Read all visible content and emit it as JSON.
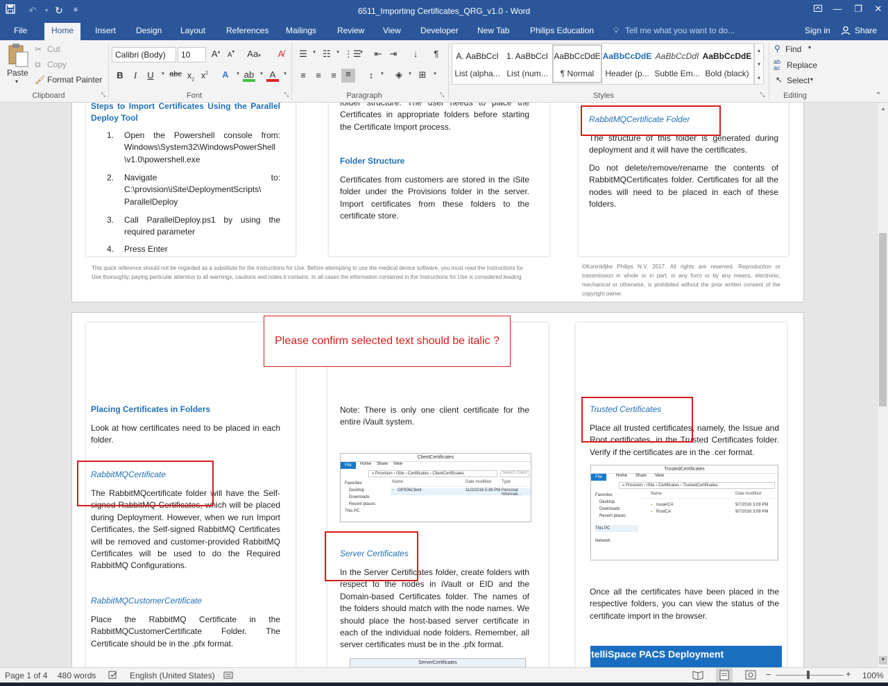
{
  "window": {
    "title": "6511_Importing Certificates_QRG_v1.0 - Word",
    "quick_access": {
      "save_icon": "save-icon",
      "undo_icon": "undo-icon",
      "redo_icon": "repeat-icon"
    }
  },
  "tabs": [
    "File",
    "Home",
    "Insert",
    "Design",
    "Layout",
    "References",
    "Mailings",
    "Review",
    "View",
    "Developer",
    "New Tab",
    "Philips Education"
  ],
  "active_tab": "Home",
  "tell_me_placeholder": "Tell me what you want to do...",
  "account": {
    "sign_in": "Sign in",
    "share": "Share"
  },
  "ribbon": {
    "clipboard": {
      "paste": "Paste",
      "cut": "Cut",
      "copy": "Copy",
      "format_painter": "Format Painter",
      "label": "Clipboard"
    },
    "font": {
      "font_name": "Calibri (Body)",
      "font_size": "10",
      "label": "Font"
    },
    "paragraph": {
      "label": "Paragraph"
    },
    "styles": {
      "label": "Styles",
      "items": [
        {
          "preview": "A. AaBbCcI",
          "name": "List (alpha..."
        },
        {
          "preview": "1. AaBbCcI",
          "name": "List (num..."
        },
        {
          "preview": "AaBbCcDdE",
          "name": "¶ Normal"
        },
        {
          "preview": "AaBbCcDdE",
          "name": "Header (p..."
        },
        {
          "preview": "AaBbCcDdI",
          "name": "Subtle Em..."
        },
        {
          "preview": "AaBbCcDdE",
          "name": "Bold (black)"
        }
      ]
    },
    "editing": {
      "find": "Find",
      "replace": "Replace",
      "select": "Select",
      "label": "Editing"
    }
  },
  "page1": {
    "col1": {
      "heading": "Steps to Import Certificates Using the Parallel Deploy Tool",
      "steps": [
        {
          "num": "1.",
          "text": "Open the Powershell console from: Windows\\System32\\WindowsPowerShell \\v1.0\\powershell.exe"
        },
        {
          "num": "2.",
          "text": "Navigate to: C:\\provision\\iSite\\DeploymentScripts\\ ParallelDeploy"
        },
        {
          "num": "3.",
          "text": "Call ParallelDeploy.ps1 by using the required parameter"
        },
        {
          "num": "4.",
          "text": "Press Enter"
        }
      ]
    },
    "col2": {
      "intro": "folder structure. The user needs to place the Certificates in appropriate folders before starting the Certificate Import process.",
      "heading": "Folder Structure",
      "body": "Certificates from customers are stored in the iSite folder under the Provisions folder in the server. Import certificates from these folders to the certificate store."
    },
    "col3": {
      "heading": "RabbitMQCertificate Folder",
      "p1": "The structure of this folder is generated during deployment and it will have the certificates.",
      "p2": "Do not delete/remove/rename the contents of RabbitMQCertificates folder. Certificates for all the nodes will need to be placed in each of these folders."
    },
    "footer_left": "This quick reference should not be regarded as a substitute for the Instructions for Use. Before attempting to use the medical device software, you must read the Instructions for Use thoroughly, paying particular attention to all warnings, cautions and notes it contains. In all cases the information contained in the Instructions for Use is considered leading.",
    "footer_right": "©Koninklijke Philips N.V. 2017. All rights are reserved. Reproduction or transmission in whole or in part, in any form or by any means, electronic, mechanical or otherwise, is prohibited without the prior written consent of the copyright owner."
  },
  "page2": {
    "comment": "Please confirm selected text should be italic ?",
    "col1": {
      "heading": "Placing Certificates in Folders",
      "intro": "Look at how certificates need to be placed in each folder.",
      "sub1": "RabbitMQCertificate",
      "body1": "The RabbitMQcertificate folder will have the Self-signed RabbitMQ Certificates, which will be placed during Deployment. However, when we run Import Certificates, the Self-signed RabbitMQ Certificates will be removed and customer-provided RabbitMQ Certificates will be used to do the Required RabbitMQ Configurations.",
      "sub2": "RabbitMQCustomerCertificate",
      "body2": "Place the RabbitMQ Certificate in the RabbitMQCustomerCertificate Folder. The Certificate should be in the .pfx format."
    },
    "col2": {
      "note": "Note: There is only one client certificate for the entire iVault system.",
      "shot1": {
        "title": "ClientCertificates",
        "menu": [
          "File",
          "Home",
          "Share",
          "View"
        ],
        "path": "« Provision › iSite › Certificates › ClientCertificates",
        "search": "Search Client",
        "nav": [
          "Favorites",
          "Desktop",
          "Downloads",
          "Recent places",
          "This PC"
        ],
        "cols": [
          "Name",
          "Date modified",
          "Type"
        ],
        "rows": [
          {
            "name": "OPS06Client",
            "date": "11/2/2016 5:36 PM",
            "type": "Personal Informati..."
          }
        ]
      },
      "sub": "Server Certificates",
      "body": "In the Server Certificates folder, create folders with respect to the nodes in iVault or EID and the Domain-based Certificates folder. The names of the folders should match with the node names. We should place the host-based server certificate in each of the individual node folders. Remember, all server certificates must be in the .pfx format.",
      "shot2_title": "ServerCertificates"
    },
    "col3": {
      "sub": "Trusted Certificates",
      "body": "Place all trusted certificates, namely, the Issue and Root certificates, in the Trusted Certificates folder. Verify if the certificates are in the .cer format.",
      "shot": {
        "title": "TrustedCertificates",
        "menu": [
          "File",
          "Home",
          "Share",
          "View"
        ],
        "path": "« Provision › iSite › Certificates › TrustedCertificates",
        "nav": [
          "Favorites",
          "Desktop",
          "Downloads",
          "Recent places",
          "This PC",
          "Network"
        ],
        "cols": [
          "Name",
          "Date modified"
        ],
        "rows": [
          {
            "name": "IssuerCA",
            "date": "9/7/2016 3:09 PM"
          },
          {
            "name": "RootCA",
            "date": "9/7/2016 3:09 PM"
          }
        ]
      },
      "body2": "Once all the certificates have been placed in the respective folders, you can view the status of the certificate import in the browser.",
      "banner": "telliSpace PACS Deployment"
    }
  },
  "status": {
    "page": "Page 1 of 4",
    "words": "480 words",
    "language": "English (United States)",
    "zoom": "100%"
  },
  "colors": {
    "brand": "#2b579a",
    "heading": "#1f6fb5",
    "comment_red": "#d51b1b"
  }
}
